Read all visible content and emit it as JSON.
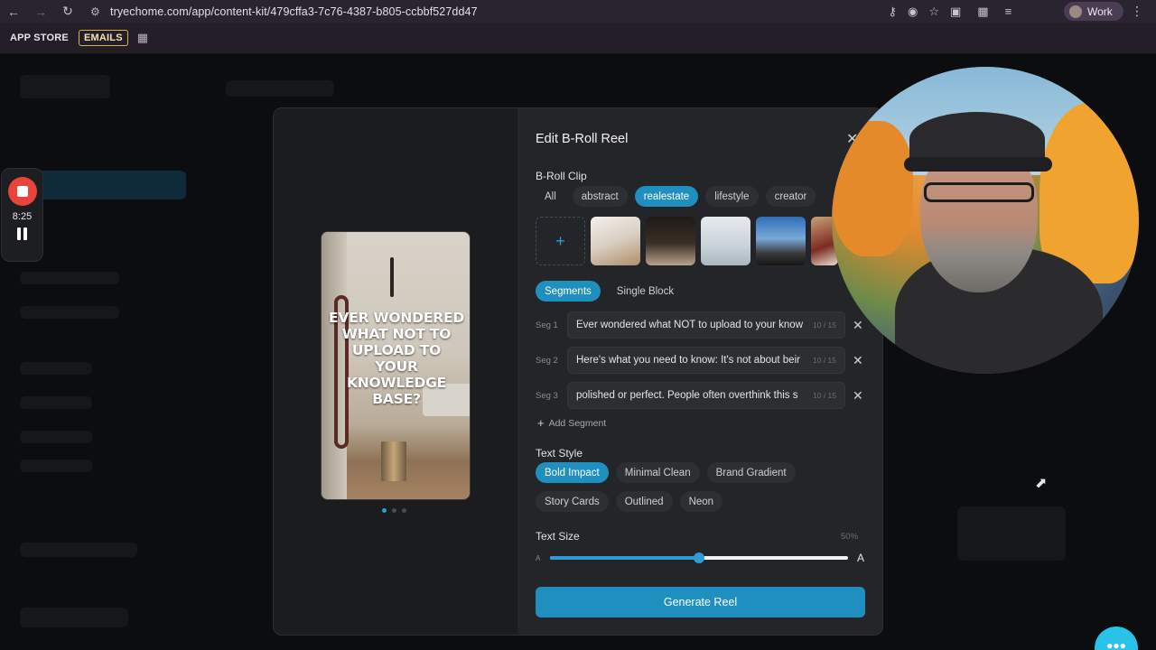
{
  "browser": {
    "url": "tryechome.com/app/content-kit/479cffa3-7c76-4387-b805-ccbbf527dd47",
    "profile_label": "Work",
    "bookmarks": [
      {
        "label": "APP STORE"
      },
      {
        "label": "EMAILS"
      }
    ]
  },
  "recorder": {
    "time": "8:25"
  },
  "modal": {
    "title": "Edit B-Roll Reel",
    "preview": {
      "caption": "EVER WONDERED WHAT NOT TO UPLOAD TO YOUR KNOWLEDGE BASE?",
      "page_count": 3,
      "current_page": 1
    },
    "broll": {
      "label": "B-Roll Clip",
      "filters": [
        {
          "label": "All",
          "active": false
        },
        {
          "label": "abstract",
          "active": false
        },
        {
          "label": "realestate",
          "active": true
        },
        {
          "label": "lifestyle",
          "active": false
        },
        {
          "label": "creator",
          "active": false
        }
      ],
      "add_icon": "plus-icon"
    },
    "mode": {
      "options": [
        {
          "label": "Segments",
          "active": true
        },
        {
          "label": "Single Block",
          "active": false
        }
      ]
    },
    "segments": [
      {
        "label": "Seg 1",
        "text": "Ever wondered what NOT to upload to your know",
        "count": "10 / 15"
      },
      {
        "label": "Seg 2",
        "text": "Here's what you need to know: It's not about beir",
        "count": "10 / 15"
      },
      {
        "label": "Seg 3",
        "text": "polished or perfect. People often overthink this s",
        "count": "10 / 15"
      }
    ],
    "add_segment_label": "Add Segment",
    "text_style": {
      "label": "Text Style",
      "options": [
        {
          "label": "Bold Impact",
          "active": true
        },
        {
          "label": "Minimal Clean",
          "active": false
        },
        {
          "label": "Brand Gradient",
          "active": false
        },
        {
          "label": "Story Cards",
          "active": false
        },
        {
          "label": "Outlined",
          "active": false
        },
        {
          "label": "Neon",
          "active": false
        }
      ]
    },
    "text_size": {
      "label": "Text Size",
      "value_label": "50%",
      "value": 0.5,
      "min_label": "A",
      "max_label": "A"
    },
    "generate_label": "Generate Reel"
  },
  "colors": {
    "accent": "#1f8fc0",
    "recorder_red": "#e8443a"
  }
}
